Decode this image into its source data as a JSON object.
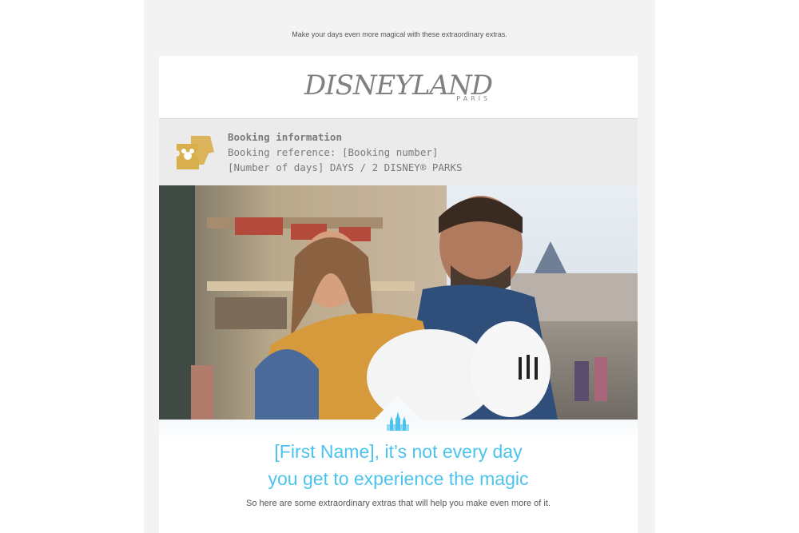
{
  "preheader": "Make your days even more magical with these extraordinary extras.",
  "logo": {
    "main": "DISNEYLAND",
    "sub": "PARIS"
  },
  "booking": {
    "title": "Booking information",
    "reference": "Booking reference: [Booking number]",
    "days": "[Number of days] DAYS / 2 DISNEY® PARKS",
    "icon": "ticket-icon",
    "icon_color": "#d9ae4c"
  },
  "hero": {
    "image": "father-and-daughter-at-park-photo",
    "badge_icon": "castle-icon",
    "badge_color": "#4cc3ef"
  },
  "headline": {
    "line1": "[First Name], it’s not every day",
    "line2": "you get to experience the magic",
    "color": "#4cc3ef"
  },
  "subline": "So here are some extraordinary extras that will help you make even more of it."
}
